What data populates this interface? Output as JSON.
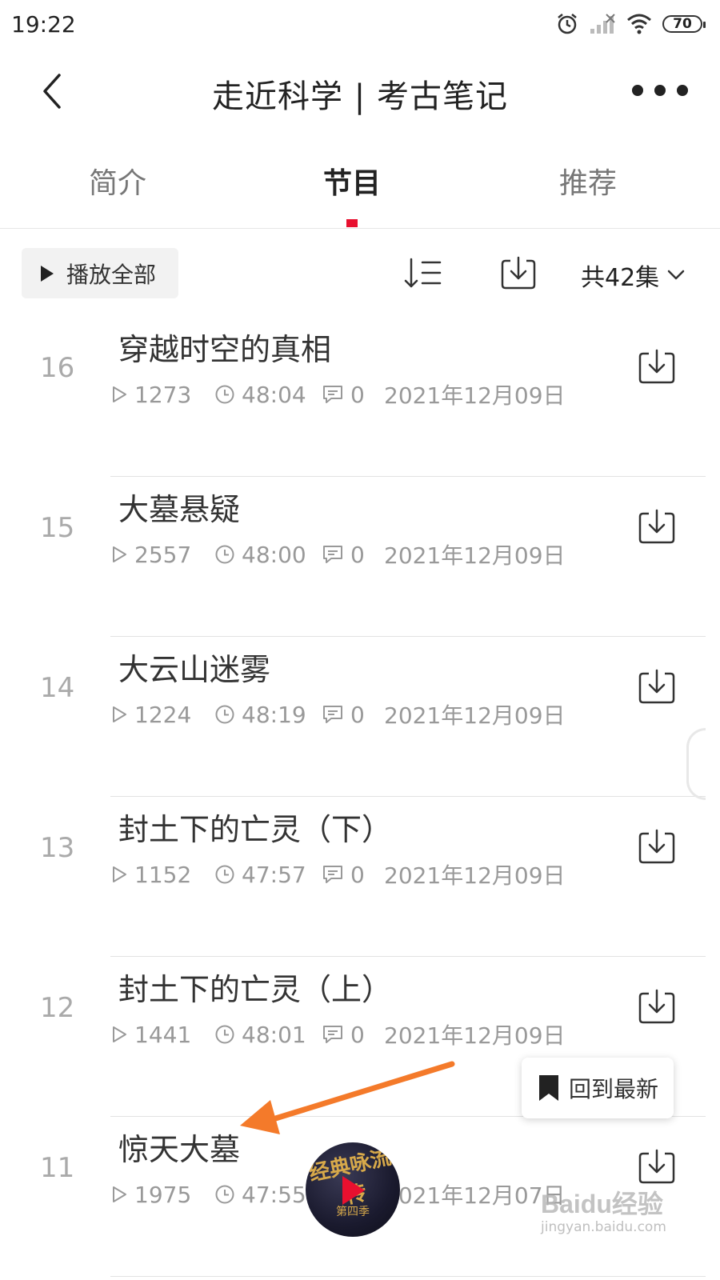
{
  "status_bar": {
    "time": "19:22",
    "battery": "70"
  },
  "header": {
    "title": "走近科学 | 考古笔记"
  },
  "tabs": [
    {
      "label": "简介",
      "active": false
    },
    {
      "label": "节目",
      "active": true
    },
    {
      "label": "推荐",
      "active": false
    }
  ],
  "toolbar": {
    "play_all": "播放全部",
    "count": "共42集"
  },
  "episodes": [
    {
      "num": "16",
      "title": "穿越时空的真相",
      "plays": "1273",
      "duration": "48:04",
      "comments": "0",
      "date": "2021年12月09日"
    },
    {
      "num": "15",
      "title": "大墓悬疑",
      "plays": "2557",
      "duration": "48:00",
      "comments": "0",
      "date": "2021年12月09日"
    },
    {
      "num": "14",
      "title": "大云山迷雾",
      "plays": "1224",
      "duration": "48:19",
      "comments": "0",
      "date": "2021年12月09日"
    },
    {
      "num": "13",
      "title": "封土下的亡灵（下）",
      "plays": "1152",
      "duration": "47:57",
      "comments": "0",
      "date": "2021年12月09日"
    },
    {
      "num": "12",
      "title": "封土下的亡灵（上）",
      "plays": "1441",
      "duration": "48:01",
      "comments": "0",
      "date": "2021年12月09日"
    },
    {
      "num": "11",
      "title": "惊天大墓",
      "plays": "1975",
      "duration": "47:55",
      "comments": "",
      "date": "2021年12月07日"
    }
  ],
  "back_to_latest": "回到最新",
  "mini_player": {
    "cover_text": "经典咏流传",
    "cover_sub": "第四季"
  },
  "watermark": {
    "main": "Baidu经验",
    "sub": "jingyan.baidu.com"
  },
  "colors": {
    "accent": "#e8102f",
    "annotation_arrow": "#f47a2a"
  }
}
